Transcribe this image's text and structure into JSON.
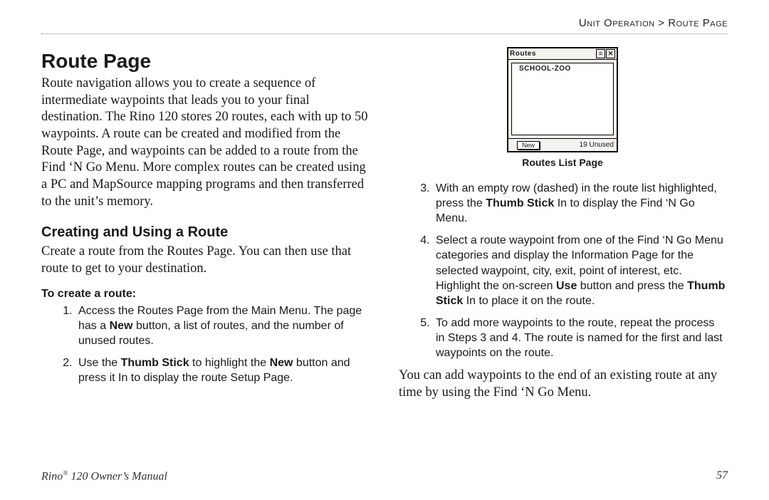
{
  "breadcrumb": "Unit Operation > Route Page",
  "left": {
    "h1": "Route Page",
    "p1": "Route navigation allows you to create a sequence of intermediate waypoints that leads you to your final destination. The Rino 120 stores 20 routes, each with up to 50 waypoints. A route can be created and modified from the Route Page, and waypoints can be added to a route from the Find ‘N Go Menu. More complex routes can be created using a PC and MapSource mapping programs and then transferred to the unit’s memory.",
    "h2": "Creating and Using a Route",
    "p2": "Create a route from the Routes Page. You can then use that route to get to your destination.",
    "h3": "To create a route:",
    "step1_a": "Access the Routes Page from the Main Menu. The page has a ",
    "step1_bold": "New",
    "step1_b": " button, a list of routes, and the number of unused routes.",
    "step2_a": "Use the ",
    "step2_bold1": "Thumb Stick",
    "step2_b": " to highlight the ",
    "step2_bold2": "New",
    "step2_c": " button and press it In to display the route Setup Page."
  },
  "figure": {
    "title": "Routes",
    "item": "SCHOOL-ZOO",
    "new": "New",
    "unused": "19 Unused",
    "caption": "Routes List Page"
  },
  "right": {
    "step3_a": "With an empty row (dashed) in the route list highlighted, press the ",
    "step3_bold": "Thumb Stick",
    "step3_b": " In to display the Find ‘N Go Menu.",
    "step4_a": "Select a route waypoint from one of the Find ‘N Go Menu categories and display the Information Page for the selected waypoint, city, exit, point of interest, etc. Highlight the on-screen ",
    "step4_bold1": "Use",
    "step4_b": " button and press the ",
    "step4_bold2": "Thumb Stick",
    "step4_c": " In to place it on the route.",
    "step5": "To add more waypoints to the route, repeat the process in Steps 3 and 4. The route is named for the first and last waypoints on the route.",
    "closing": "You can add waypoints to the end of an existing route at any time by using the Find ‘N Go Menu."
  },
  "footer": {
    "manual_a": "Rino",
    "manual_b": " 120 Owner’s Manual",
    "page": "57"
  }
}
